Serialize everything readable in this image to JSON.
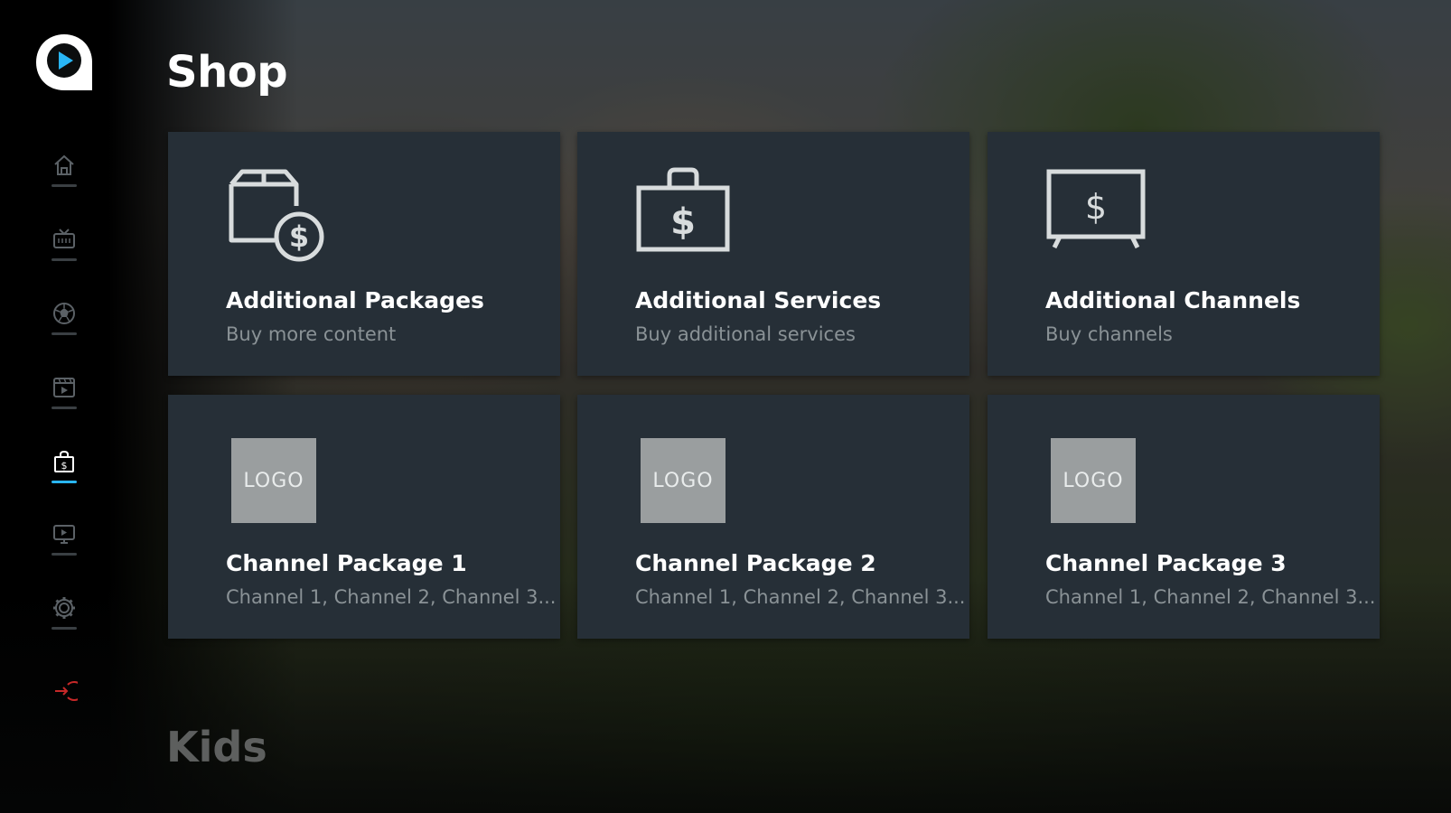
{
  "page": {
    "title": "Shop",
    "next_section_title": "Kids"
  },
  "colors": {
    "accent": "#29b6f6",
    "card_bg": "#262f37",
    "logout_red": "#c62828",
    "nav_icon": "#5b6166"
  },
  "sidebar": {
    "logo_icon": "app-logo-icon",
    "items": [
      {
        "name": "home",
        "icon": "home-icon",
        "active": false
      },
      {
        "name": "tv",
        "icon": "tv-icon",
        "active": false
      },
      {
        "name": "sports",
        "icon": "soccer-ball-icon",
        "active": false
      },
      {
        "name": "movies",
        "icon": "film-icon",
        "active": false
      },
      {
        "name": "shop",
        "icon": "shopping-bag-icon",
        "active": true
      },
      {
        "name": "recordings",
        "icon": "screen-icon",
        "active": false
      },
      {
        "name": "settings",
        "icon": "gear-icon",
        "active": false
      },
      {
        "name": "logout",
        "icon": "logout-icon",
        "active": false
      }
    ]
  },
  "cards": [
    {
      "title": "Additional Packages",
      "subtitle": "Buy more content",
      "icon": "package-dollar-icon"
    },
    {
      "title": "Additional Services",
      "subtitle": "Buy additional services",
      "icon": "bag-dollar-icon"
    },
    {
      "title": "Additional Channels",
      "subtitle": "Buy channels",
      "icon": "tv-dollar-icon"
    },
    {
      "title": "Channel Package 1",
      "subtitle": "Channel 1, Channel 2, Channel 3...",
      "logo": "LOGO"
    },
    {
      "title": "Channel Package 2",
      "subtitle": "Channel 1, Channel 2, Channel 3...",
      "logo": "LOGO"
    },
    {
      "title": "Channel Package 3",
      "subtitle": "Channel 1, Channel 2, Channel 3...",
      "logo": "LOGO"
    }
  ]
}
